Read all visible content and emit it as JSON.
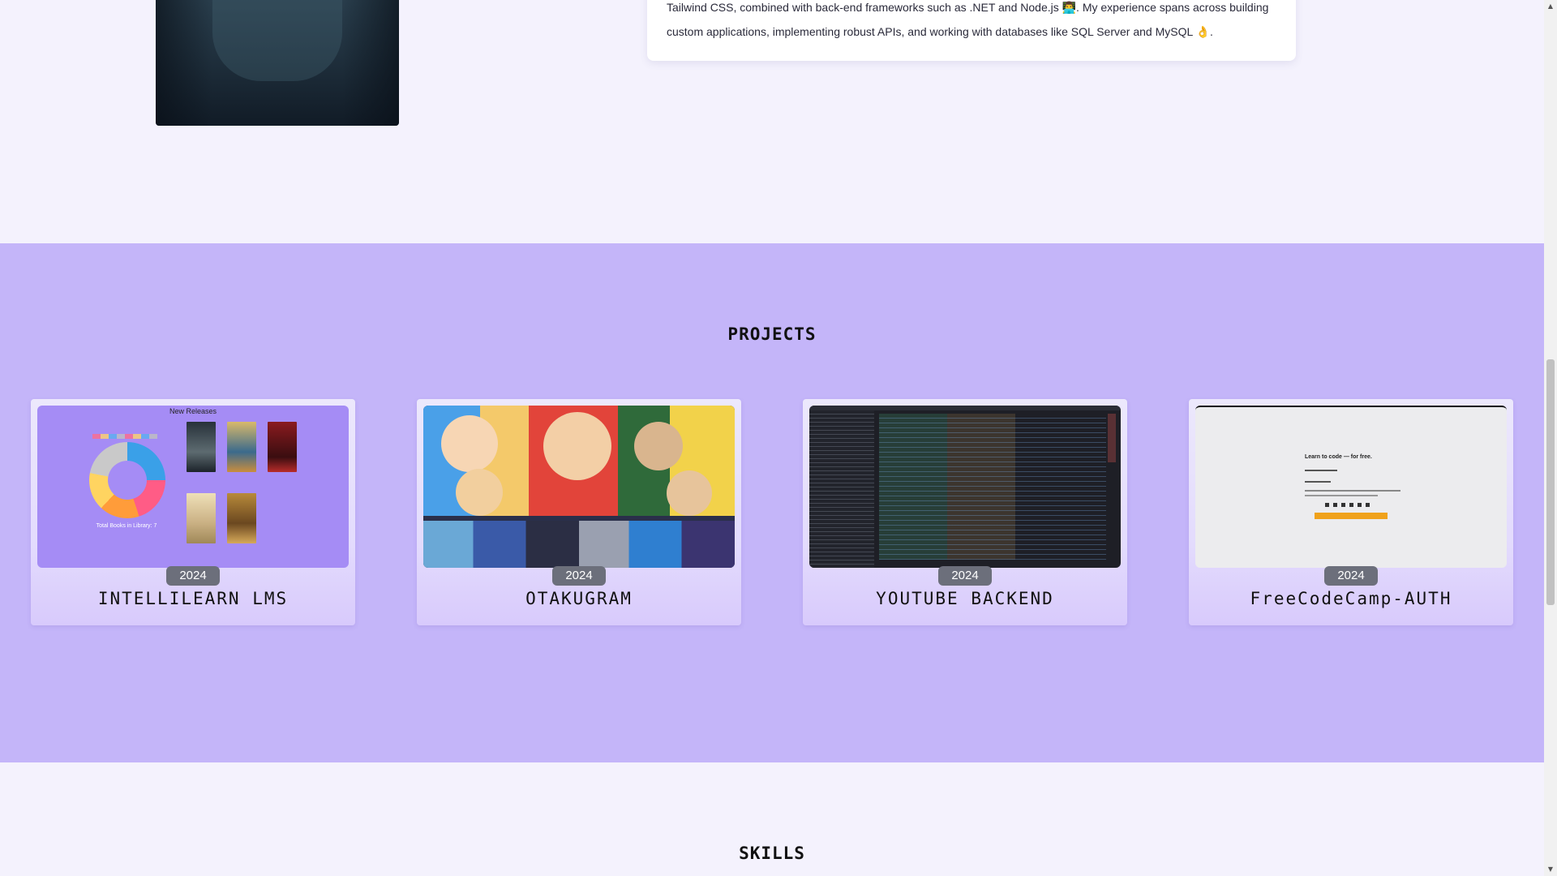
{
  "about": {
    "line1": "Tailwind CSS, combined with back-end frameworks such as .NET and Node.js 👨‍💻. My experience spans across building",
    "line2": "custom applications, implementing robust APIs, and working with databases like SQL Server and MySQL 👌."
  },
  "projects": {
    "title": "PROJECTS",
    "items": [
      {
        "year": "2024",
        "name": "INTELLILEARN LMS",
        "thumb_heading": "New Releases",
        "thumb_caption": "Total Books in Library: 7"
      },
      {
        "year": "2024",
        "name": "OTAKUGRAM"
      },
      {
        "year": "2024",
        "name": "YOUTUBE BACKEND"
      },
      {
        "year": "2024",
        "name": "FreeCodeCamp-AUTH",
        "thumb_heading": "Learn to code — for free."
      }
    ]
  },
  "skills": {
    "title": "SKILLS"
  },
  "scrollbar": {
    "up_icon": "▲",
    "down_icon": "▼"
  },
  "colors": {
    "projects_bg": "#c4b5f9",
    "page_bg": "#f4f2fd",
    "badge": "#6c6f7b"
  }
}
